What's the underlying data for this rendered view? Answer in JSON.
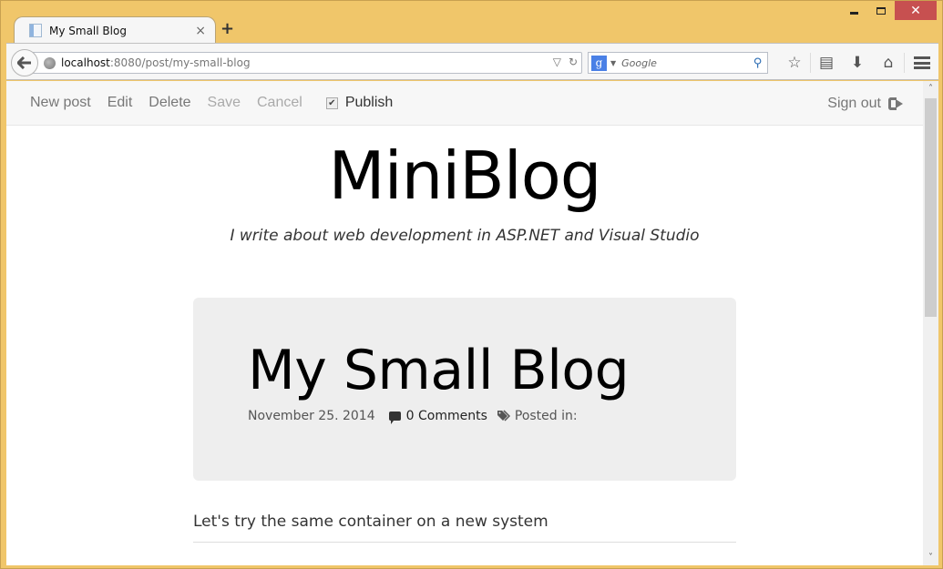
{
  "browser": {
    "tab": {
      "title": "My Small Blog",
      "close_glyph": "×"
    },
    "new_tab_glyph": "+",
    "window_controls": {
      "close_glyph": "✕"
    },
    "url": {
      "host": "localhost",
      "rest": ":8080/post/my-small-blog"
    },
    "url_actions": {
      "dropdown_glyph": "▽",
      "reload_glyph": "↻"
    },
    "search": {
      "engine_glyph": "g",
      "placeholder": "Google"
    },
    "toolbar_icons": {
      "bookmark": "☆",
      "reading_list": "▤",
      "downloads": "⬇",
      "home": "⌂"
    },
    "scroll": {
      "up_glyph": "˄",
      "down_glyph": "˅"
    }
  },
  "adminbar": {
    "links": {
      "new_post": "New post",
      "edit": "Edit",
      "delete": "Delete",
      "save": "Save",
      "cancel": "Cancel"
    },
    "publish": {
      "label": "Publish",
      "checked": true,
      "check_glyph": "✔"
    },
    "signout": "Sign out"
  },
  "blog": {
    "title": "MiniBlog",
    "subtitle": "I write about web development in ASP.NET and Visual Studio"
  },
  "post": {
    "title": "My Small Blog",
    "date": "November 25. 2014",
    "comments": "0 Comments",
    "tag_glyph": "🏷",
    "posted_in": "Posted in:",
    "excerpt": "Let's try the same container on a new system"
  }
}
